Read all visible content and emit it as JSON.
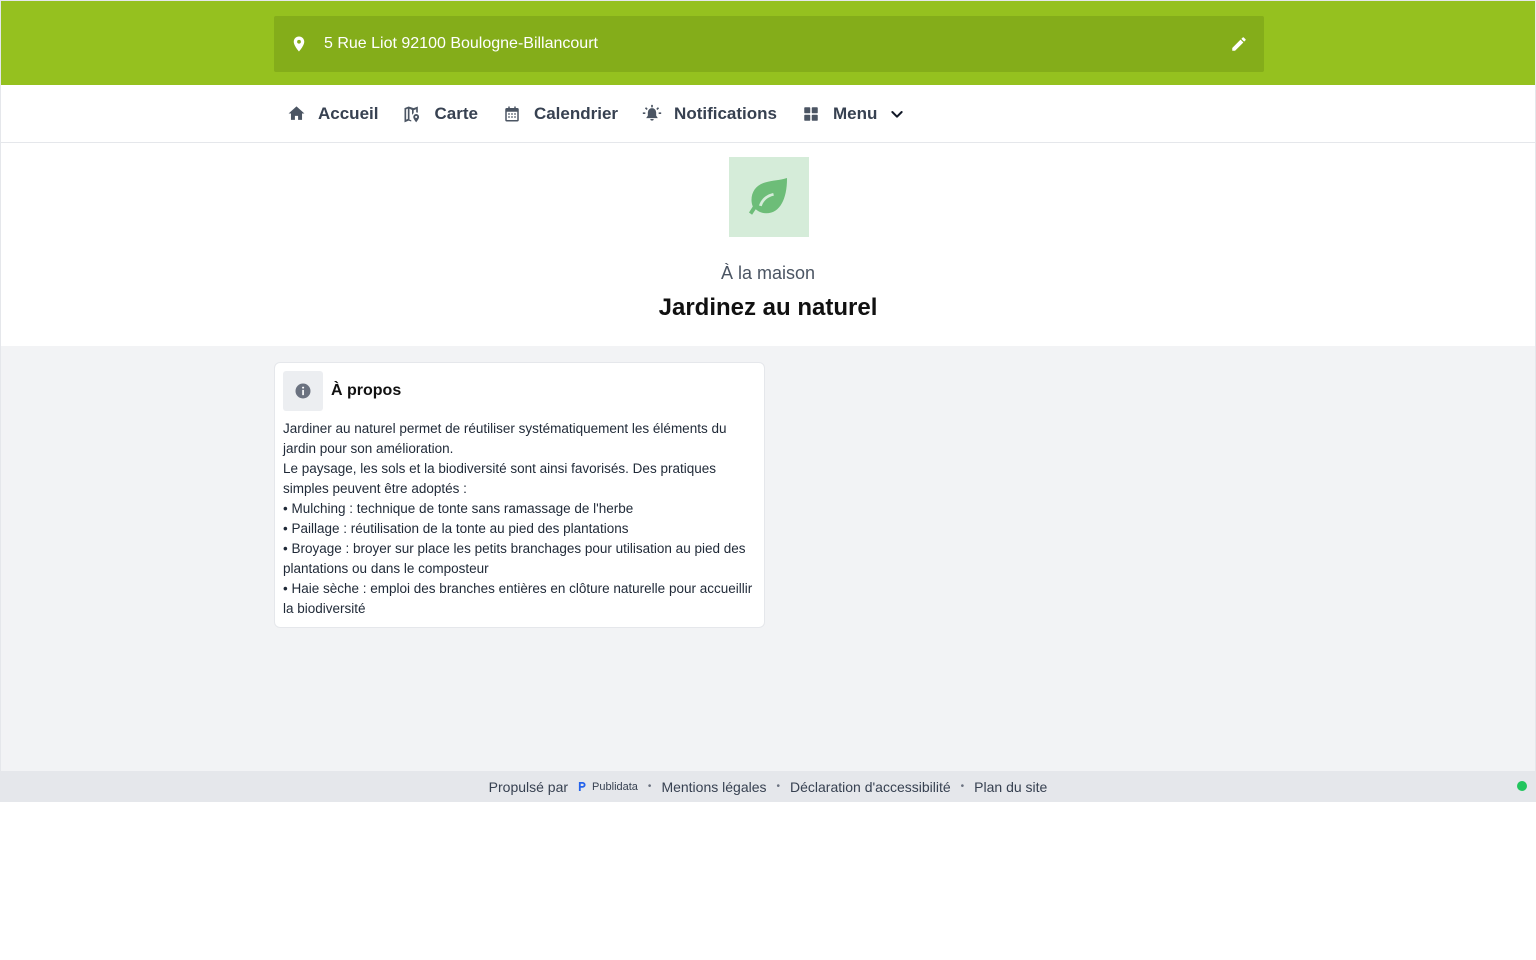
{
  "header": {
    "address": "5 Rue Liot 92100 Boulogne-Billancourt",
    "icons": [
      "map-pin-icon",
      "pencil-icon"
    ],
    "color": "#95c11f"
  },
  "nav": {
    "items": [
      {
        "label": "Accueil",
        "icon": "home-icon"
      },
      {
        "label": "Carte",
        "icon": "map-icon"
      },
      {
        "label": "Calendrier",
        "icon": "calendar-icon"
      },
      {
        "label": "Notifications",
        "icon": "bell-icon"
      },
      {
        "label": "Menu",
        "icon": "grid-icon"
      }
    ]
  },
  "hero": {
    "icon": "leaf-icon",
    "subtitle": "À la maison",
    "title": "Jardinez au naturel"
  },
  "card": {
    "title": "À propos",
    "icon": "info-icon",
    "lines": [
      "Jardiner au naturel permet de réutiliser systématiquement les éléments du jardin pour son amélioration.",
      "Le paysage, les sols et la biodiversité sont ainsi favorisés. Des pratiques simples peuvent être adoptés :",
      "• Mulching : technique de tonte sans ramassage de l'herbe",
      "• Paillage : réutilisation de la tonte au pied des plantations",
      "• Broyage : broyer sur place les petits branchages pour utilisation au pied des plantations ou dans le composteur",
      "• Haie sèche : emploi des branches entières en clôture naturelle pour accueillir la biodiversité"
    ]
  },
  "footer": {
    "powered_by": "Propulsé par",
    "brand": "Publidata",
    "links": [
      "Mentions légales",
      "Déclaration d'accessibilité",
      "Plan du site"
    ],
    "separator": "•",
    "status_color": "#22c55e"
  }
}
